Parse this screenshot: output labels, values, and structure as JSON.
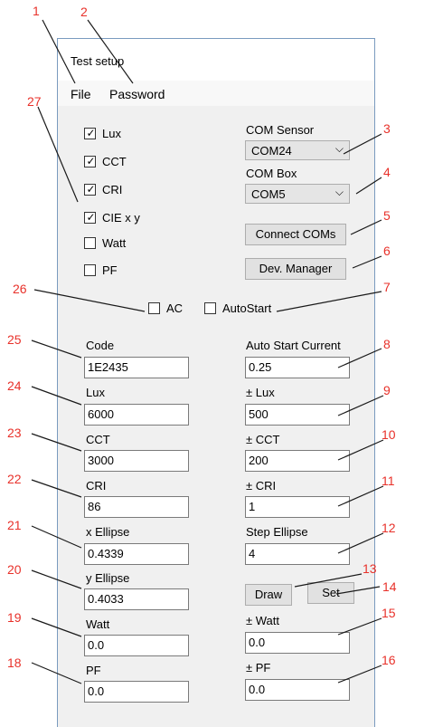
{
  "window": {
    "title": "Test setup"
  },
  "menu": {
    "file": "File",
    "password": "Password"
  },
  "checkboxes": [
    {
      "label": "Lux",
      "checked": true
    },
    {
      "label": "CCT",
      "checked": true
    },
    {
      "label": "CRI",
      "checked": true
    },
    {
      "label": "CIE x y",
      "checked": true
    },
    {
      "label": "Watt",
      "checked": false
    },
    {
      "label": "PF",
      "checked": false
    }
  ],
  "com_sensor": {
    "label": "COM Sensor",
    "value": "COM24"
  },
  "com_box": {
    "label": "COM Box",
    "value": "COM5"
  },
  "buttons": {
    "connect": "Connect COMs",
    "dev_manager": "Dev. Manager",
    "draw": "Draw",
    "set": "Set"
  },
  "options": {
    "ac": "AC",
    "autostart": "AutoStart"
  },
  "left_fields": [
    {
      "label": "Code",
      "value": "1E2435"
    },
    {
      "label": "Lux",
      "value": "6000"
    },
    {
      "label": "CCT",
      "value": "3000"
    },
    {
      "label": "CRI",
      "value": "86"
    },
    {
      "label": "x Ellipse",
      "value": "0.4339"
    },
    {
      "label": "y Ellipse",
      "value": "0.4033"
    },
    {
      "label": "Watt",
      "value": "0.0"
    },
    {
      "label": "PF",
      "value": "0.0"
    }
  ],
  "right_fields": {
    "auto_start_current": {
      "label": "Auto Start Current",
      "value": "0.25"
    },
    "lux_tol": {
      "label": "± Lux",
      "value": "500"
    },
    "cct_tol": {
      "label": "± CCT",
      "value": "200"
    },
    "cri_tol": {
      "label": "± CRI",
      "value": "1"
    },
    "step_ellipse": {
      "label": "Step Ellipse",
      "value": "4"
    },
    "watt_tol": {
      "label": "± Watt",
      "value": "0.0"
    },
    "pf_tol": {
      "label": "± PF",
      "value": "0.0"
    }
  },
  "annotations": [
    "1",
    "2",
    "3",
    "4",
    "5",
    "6",
    "7",
    "8",
    "9",
    "10",
    "11",
    "12",
    "13",
    "14",
    "15",
    "16",
    "18",
    "19",
    "20",
    "21",
    "22",
    "23",
    "24",
    "25",
    "26",
    "27"
  ],
  "colors": {
    "annotation": "#e8312a",
    "window_border": "#7a9bbf"
  }
}
